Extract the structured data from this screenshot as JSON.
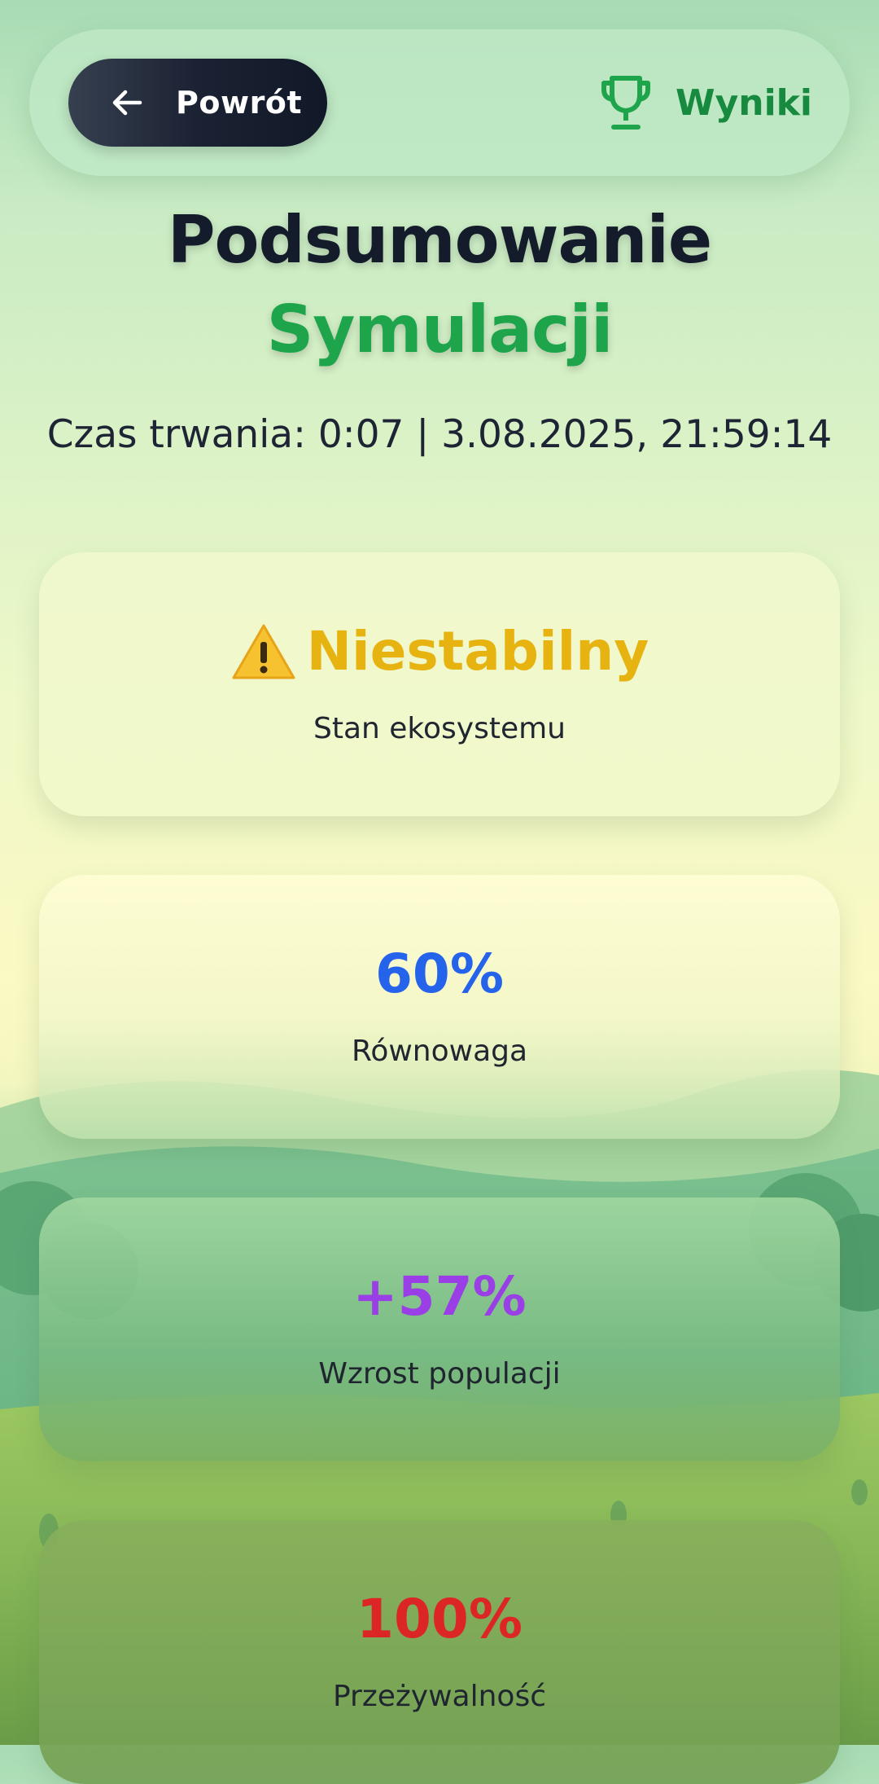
{
  "header": {
    "back_label": "Powrót",
    "results_label": "Wyniki"
  },
  "title": {
    "line1": "Podsumowanie",
    "line2": "Symulacji"
  },
  "meta": {
    "text": "Czas trwania: 0:07 | 3.08.2025, 21:59:14"
  },
  "cards": [
    {
      "value": "Niestabilny",
      "caption": "Stan ekosystemu",
      "icon": "warning-icon",
      "color": "#e6b311"
    },
    {
      "value": "60%",
      "caption": "Równowaga",
      "color": "#2563eb"
    },
    {
      "value": "+57%",
      "caption": "Wzrost populacji",
      "color": "#9a3ee6"
    },
    {
      "value": "100%",
      "caption": "Przeżywalność",
      "color": "#dc2626"
    }
  ],
  "icons": {
    "back": "arrow-left-icon",
    "results": "trophy-icon"
  },
  "colors": {
    "accent_green": "#1ea54c",
    "dark": "#141b2b"
  }
}
